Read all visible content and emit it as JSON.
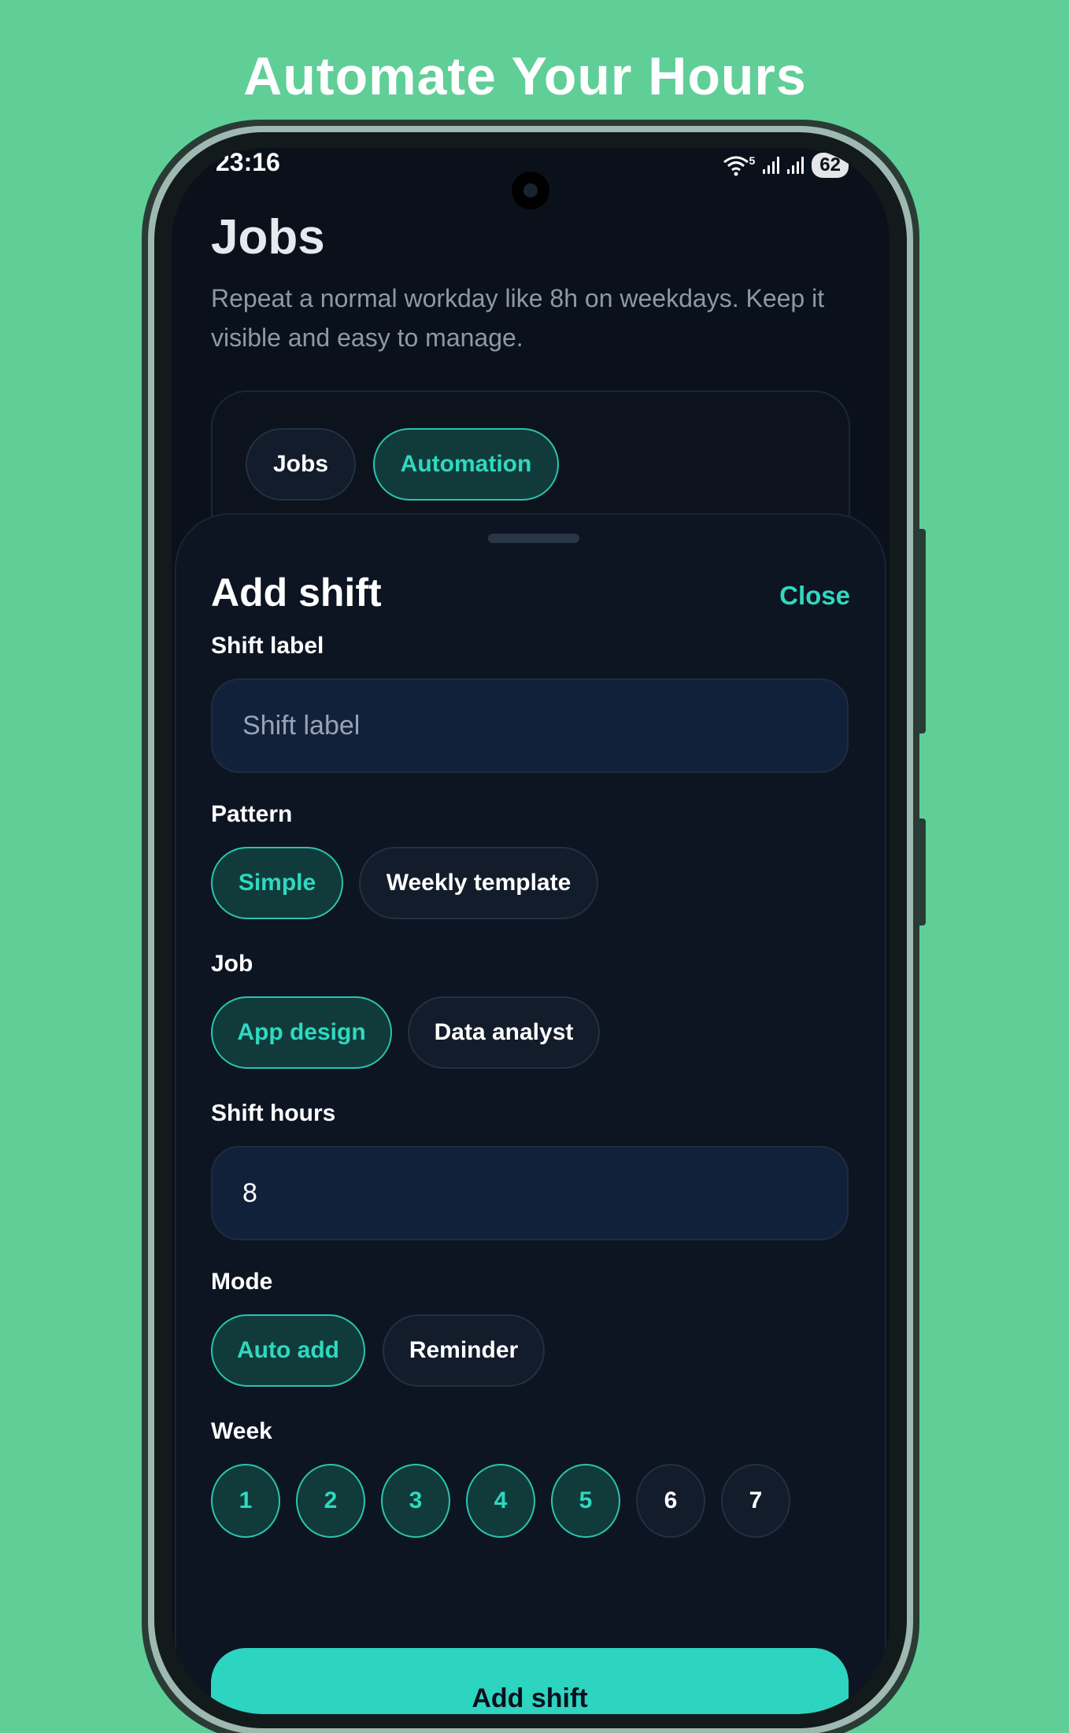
{
  "headline": "Automate Your Hours",
  "status_bar": {
    "time": "23:16",
    "wifi_label": "5",
    "battery": "62"
  },
  "page": {
    "title": "Jobs",
    "description": "Repeat a normal workday like 8h on weekdays. Keep it visible and easy to manage."
  },
  "tabs": [
    {
      "label": "Jobs",
      "active": false
    },
    {
      "label": "Automation",
      "active": true
    }
  ],
  "sheet": {
    "title": "Add shift",
    "close_label": "Close",
    "shift_label": {
      "label": "Shift label",
      "placeholder": "Shift label",
      "value": ""
    },
    "pattern": {
      "label": "Pattern",
      "options": [
        {
          "label": "Simple",
          "active": true
        },
        {
          "label": "Weekly template",
          "active": false
        }
      ]
    },
    "job": {
      "label": "Job",
      "options": [
        {
          "label": "App design",
          "active": true
        },
        {
          "label": "Data analyst",
          "active": false
        }
      ]
    },
    "shift_hours": {
      "label": "Shift hours",
      "value": "8"
    },
    "mode": {
      "label": "Mode",
      "options": [
        {
          "label": "Auto add",
          "active": true
        },
        {
          "label": "Reminder",
          "active": false
        }
      ]
    },
    "week": {
      "label": "Week",
      "days": [
        {
          "label": "1",
          "active": true
        },
        {
          "label": "2",
          "active": true
        },
        {
          "label": "3",
          "active": true
        },
        {
          "label": "4",
          "active": true
        },
        {
          "label": "5",
          "active": true
        },
        {
          "label": "6",
          "active": false
        },
        {
          "label": "7",
          "active": false
        }
      ]
    },
    "submit_label": "Add shift"
  },
  "colors": {
    "background": "#5fcf97",
    "screen": "#0b111b",
    "accent": "#2dd4c0"
  }
}
